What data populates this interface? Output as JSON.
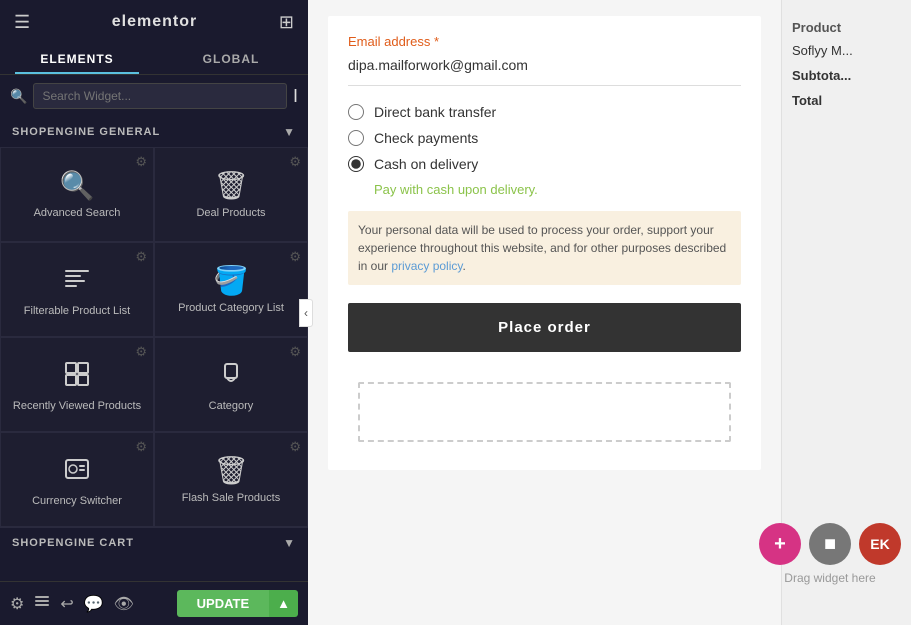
{
  "app": {
    "title": "elementor",
    "hamburger_icon": "☰",
    "grid_icon": "⊞"
  },
  "tabs": [
    {
      "label": "ELEMENTS",
      "active": true
    },
    {
      "label": "GLOBAL",
      "active": false
    }
  ],
  "search": {
    "placeholder": "Search Widget..."
  },
  "sections": [
    {
      "id": "shopengine-general",
      "label": "SHOPENGINE GENERAL",
      "widgets": [
        {
          "id": "advanced-search",
          "label": "Advanced Search",
          "icon": "🔍"
        },
        {
          "id": "deal-products",
          "label": "Deal Products",
          "icon": "🗑"
        },
        {
          "id": "filterable-product-list",
          "label": "Filterable Product List",
          "icon": "☰"
        },
        {
          "id": "product-category-list",
          "label": "Product Category List",
          "icon": "🪣"
        },
        {
          "id": "recently-viewed-products",
          "label": "Recently Viewed Products",
          "icon": "⊡"
        },
        {
          "id": "category",
          "label": "Category",
          "icon": "🔒"
        },
        {
          "id": "currency-switcher",
          "label": "Currency Switcher",
          "icon": "⊡"
        },
        {
          "id": "flash-sale-products",
          "label": "Flash Sale Products",
          "icon": "🗑"
        }
      ]
    }
  ],
  "cart_section": {
    "label": "SHOPENGINE CART"
  },
  "toolbar": {
    "icons": [
      "settings",
      "layers",
      "undo",
      "chat",
      "eye"
    ],
    "update_label": "UPDATE",
    "arrow_label": "▲"
  },
  "right_panel": {
    "email_label": "Email address *",
    "email_value": "dipa.mailforwork@gmail.com",
    "payment_options": [
      {
        "id": "direct-bank",
        "label": "Direct bank transfer",
        "checked": false
      },
      {
        "id": "check-payments",
        "label": "Check payments",
        "checked": false
      },
      {
        "id": "cash-on-delivery",
        "label": "Cash on delivery",
        "checked": true
      }
    ],
    "cash_note": "Pay with cash upon delivery.",
    "privacy_text": "Your personal data will be used to process your order, support your experience throughout this website, and for other purposes described in our ",
    "privacy_link": "privacy policy",
    "place_order_label": "Place order",
    "product_col_label": "Product",
    "product_name": "Soflyy M...",
    "subtotal_label": "Subtota...",
    "total_label": "Total",
    "drag_label": "Drag widget here",
    "fab_plus": "+",
    "fab_stop": "⬛",
    "fab_ek": "EK"
  }
}
